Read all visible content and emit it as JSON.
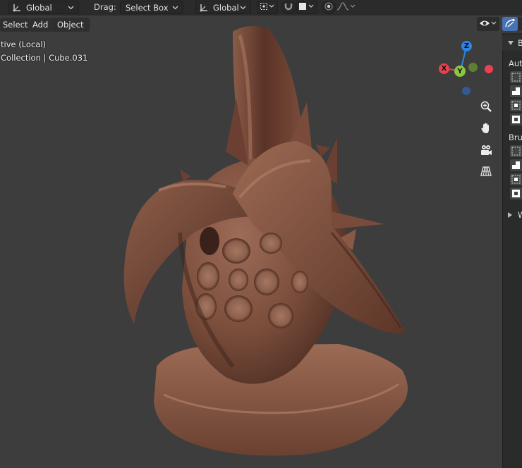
{
  "header": {
    "transform_orientation": "Global",
    "drag_label": "Drag:",
    "drag_value": "Select Box",
    "pivot_orientation": "Global"
  },
  "viewport_menu": {
    "select": "Select",
    "add": "Add",
    "object": "Object"
  },
  "viewport_info": {
    "view_name": "tive (Local)",
    "collection_object": "Collection | Cube.031"
  },
  "gizmo": {
    "z_label": "Z",
    "x_label": "X",
    "y_label": "Y",
    "colors": {
      "x": "#e8414f",
      "y": "#8bc63f",
      "z": "#2f83e4",
      "neg_x": "#9a3140",
      "neg_y": "#5c7f32",
      "neg_z": "#33598f"
    }
  },
  "nav_buttons": [
    "zoom-icon",
    "hand-icon",
    "camera-icon",
    "grid-icon"
  ],
  "sidebar": {
    "panel_label": "B",
    "auto_label": "Auto",
    "brush_label": "Brus",
    "collapsed_label": "W"
  },
  "colors": {
    "viewport_bg": "#3d3d3d",
    "header_bg": "#2b2b2b",
    "active_button": "#4772b3",
    "helmet_dark": "#4a2a21",
    "helmet_mid": "#7a4d3b",
    "helmet_light": "#a8765f"
  }
}
